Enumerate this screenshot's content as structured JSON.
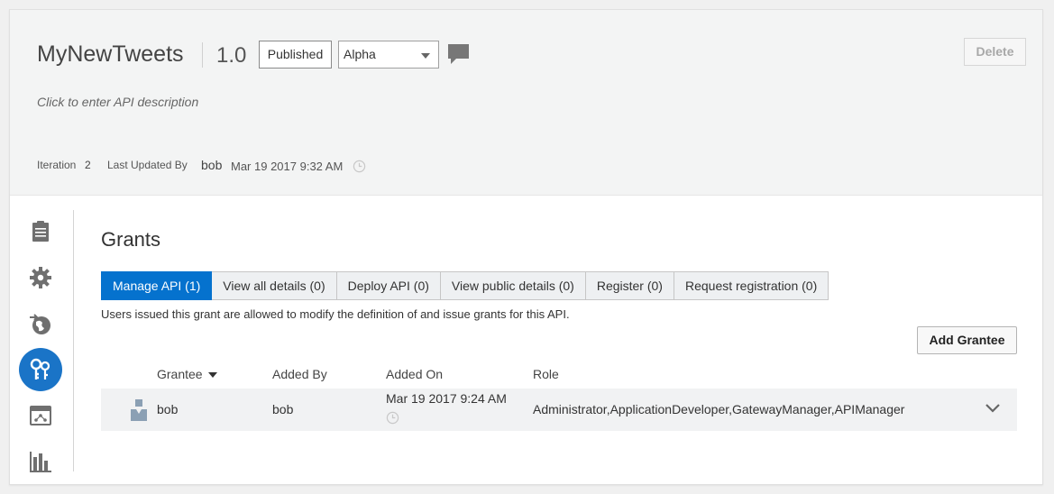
{
  "header": {
    "api_name": "MyNewTweets",
    "version": "1.0",
    "state_label": "Published",
    "stage_value": "Alpha",
    "delete_label": "Delete",
    "description_placeholder": "Click to enter API description",
    "iteration_label": "Iteration",
    "iteration_value": "2",
    "last_updated_label": "Last Updated By",
    "last_updated_user": "bob",
    "last_updated_date": "Mar 19 2017 9:32 AM"
  },
  "sidebar": {
    "items": [
      {
        "icon": "api-definition-icon"
      },
      {
        "icon": "settings-gear-icon"
      },
      {
        "icon": "deployments-globe-icon"
      },
      {
        "icon": "grants-key-icon",
        "active": true
      },
      {
        "icon": "registrations-icon"
      },
      {
        "icon": "analytics-chart-icon"
      }
    ]
  },
  "grants": {
    "title": "Grants",
    "tabs": [
      {
        "label": "Manage API (1)",
        "active": true
      },
      {
        "label": "View all details (0)"
      },
      {
        "label": "Deploy API (0)"
      },
      {
        "label": "View public details (0)"
      },
      {
        "label": "Register (0)"
      },
      {
        "label": "Request registration (0)"
      }
    ],
    "description": "Users issued this grant are allowed to modify the definition of and issue grants for this API.",
    "add_grantee_label": "Add Grantee",
    "columns": {
      "grantee": "Grantee",
      "added_by": "Added By",
      "added_on": "Added On",
      "role": "Role"
    },
    "rows": [
      {
        "grantee": "bob",
        "added_by": "bob",
        "added_on": "Mar 19 2017 9:24 AM",
        "role": "Administrator,ApplicationDeveloper,GatewayManager,APIManager"
      }
    ]
  },
  "colors": {
    "accent": "#0572ce",
    "nav_active": "#1a74c7",
    "icon_gray": "#6f6f6f"
  }
}
